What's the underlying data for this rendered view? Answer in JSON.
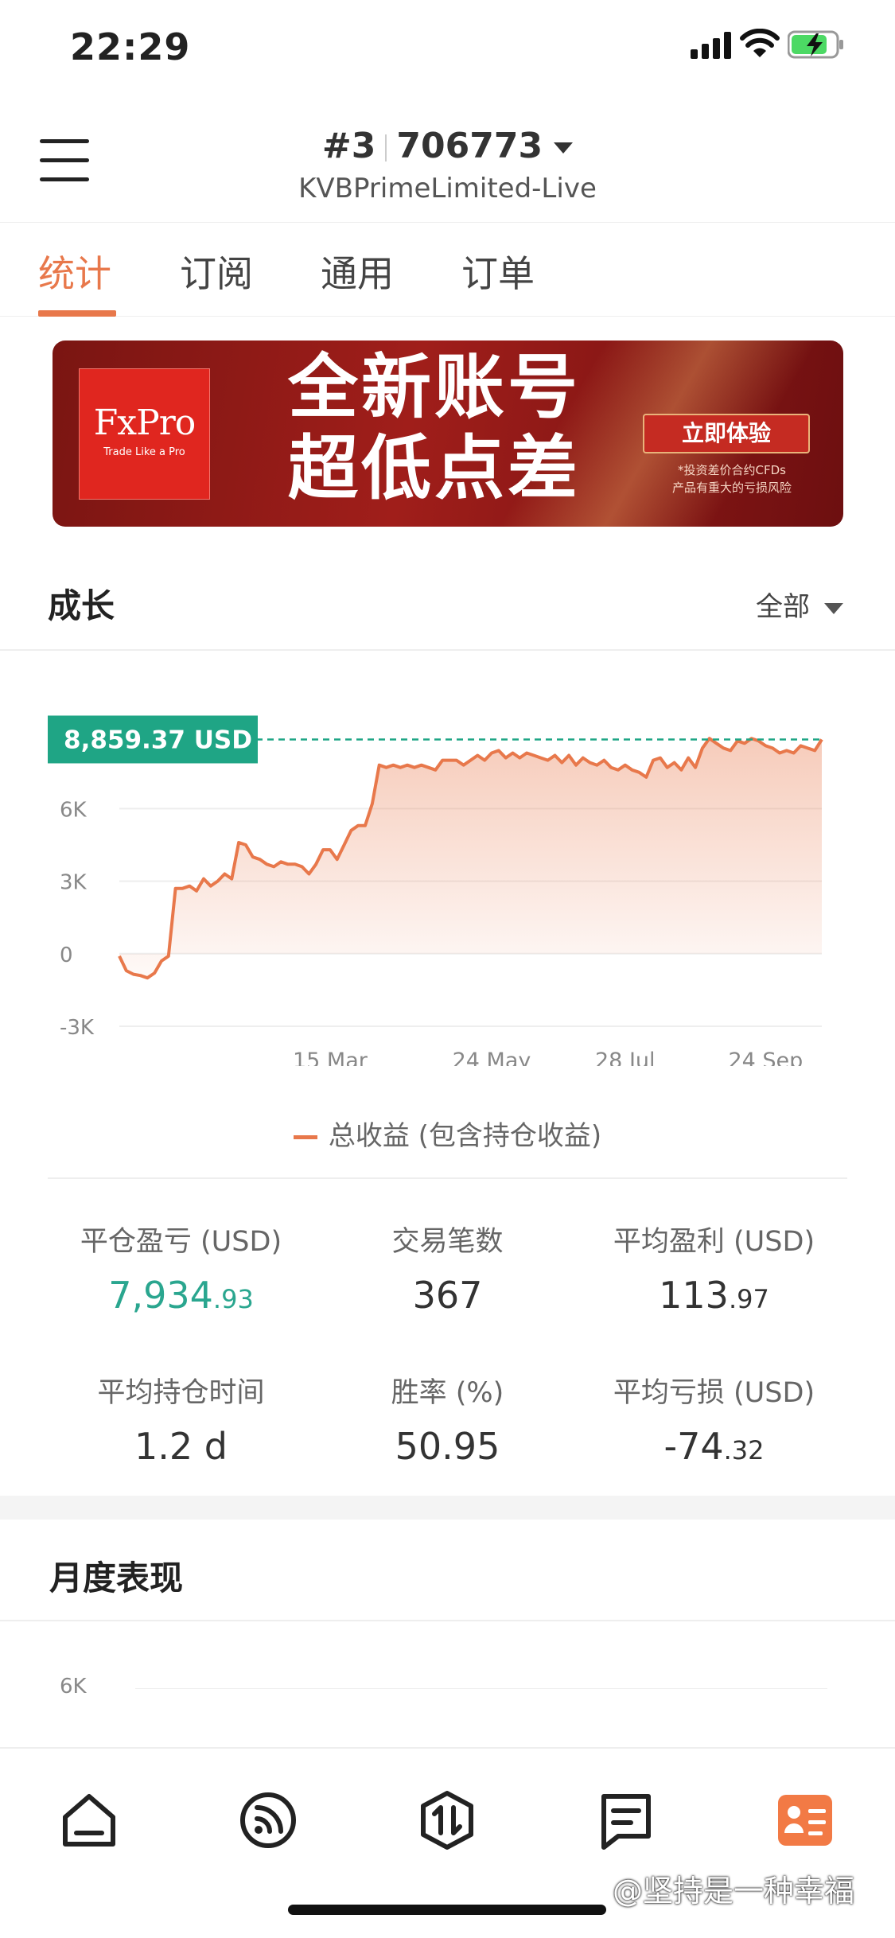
{
  "status_bar": {
    "time": "22:29"
  },
  "header": {
    "account_index": "#3",
    "account_number": "706773",
    "broker": "KVBPrimeLimited-Live"
  },
  "tabs": [
    {
      "label": "统计",
      "active": true
    },
    {
      "label": "订阅",
      "active": false
    },
    {
      "label": "通用",
      "active": false
    },
    {
      "label": "订单",
      "active": false
    }
  ],
  "banner": {
    "logo": "FxPro",
    "logo_tagline": "Trade Like a Pro",
    "headline_line1": "全新账号",
    "headline_line2": "超低点差",
    "cta": "立即体验",
    "disclaimer_line1": "*投资差价合约CFDs",
    "disclaimer_line2": "产品有重大的亏损风险"
  },
  "growth": {
    "title": "成长",
    "filter": "全部"
  },
  "chart_data": {
    "type": "area",
    "title": "",
    "current_value_label": "8,859.37 USD",
    "current_value": 8859.37,
    "y_ticks": [
      "6K",
      "3K",
      "0",
      "-3K"
    ],
    "x_ticks": [
      "15 Mar",
      "24 May",
      "28 Jul",
      "24 Sep"
    ],
    "ylim": [
      -3000,
      9500
    ],
    "grid": true,
    "legend_position": "bottom",
    "series": [
      {
        "name": "总收益 (包含持仓收益)",
        "color": "#E8784B",
        "x": [
          0,
          1,
          2,
          3,
          4,
          5,
          6,
          7,
          8,
          9,
          10,
          11,
          12,
          13,
          14,
          15,
          16,
          17,
          18,
          19,
          20,
          21,
          22,
          23,
          24,
          25,
          26,
          27,
          28,
          29,
          30,
          31,
          32,
          33,
          34,
          35,
          36,
          37,
          38,
          39,
          40,
          41,
          42,
          43,
          44,
          45,
          46,
          47,
          48,
          49,
          50,
          51,
          52,
          53,
          54,
          55,
          56,
          57,
          58,
          59,
          60,
          61,
          62,
          63,
          64,
          65,
          66,
          67,
          68,
          69,
          70,
          71,
          72,
          73,
          74,
          75,
          76,
          77,
          78,
          79,
          80,
          81,
          82,
          83,
          84,
          85,
          86,
          87,
          88,
          89,
          90,
          91,
          92,
          93,
          94,
          95,
          96,
          97,
          98,
          99,
          100
        ],
        "y": [
          -100,
          -700,
          -850,
          -900,
          -1000,
          -800,
          -300,
          -100,
          2700,
          2700,
          2800,
          2600,
          3100,
          2800,
          3000,
          3300,
          3100,
          4600,
          4500,
          4000,
          3900,
          3700,
          3600,
          3800,
          3700,
          3700,
          3600,
          3300,
          3700,
          4300,
          4300,
          3900,
          4500,
          5100,
          5300,
          5300,
          6200,
          7800,
          7700,
          7800,
          7700,
          7800,
          7700,
          7800,
          7700,
          7600,
          8000,
          8000,
          8000,
          7800,
          8000,
          8200,
          8000,
          8300,
          8400,
          8100,
          8300,
          8100,
          8300,
          8200,
          8100,
          8000,
          8200,
          7900,
          8200,
          7800,
          8100,
          7900,
          7800,
          8000,
          7700,
          7600,
          7800,
          7600,
          7500,
          7300,
          8000,
          8100,
          7700,
          7900,
          7600,
          8100,
          7700,
          8500,
          8900,
          8700,
          8500,
          8400,
          8800,
          8700,
          8900,
          8800,
          8600,
          8500,
          8300,
          8400,
          8300,
          8600,
          8500,
          8400,
          8859
        ]
      }
    ]
  },
  "stats": [
    {
      "label": "平仓盈亏 (USD)",
      "int": "7,934",
      "dec": ".93",
      "highlight": true
    },
    {
      "label": "交易笔数",
      "int": "367",
      "dec": ""
    },
    {
      "label": "平均盈利 (USD)",
      "int": "113",
      "dec": ".97"
    },
    {
      "label": "平均持仓时间",
      "int": "1.2 d",
      "dec": ""
    },
    {
      "label": "胜率 (%)",
      "int": "50.95",
      "dec": ""
    },
    {
      "label": "平均亏损 (USD)",
      "int": "-74",
      "dec": ".32"
    }
  ],
  "monthly": {
    "title": "月度表现",
    "y_tick": "6K"
  },
  "bottom_nav": [
    {
      "icon": "home-icon",
      "active": false
    },
    {
      "icon": "signal-feed-icon",
      "active": false
    },
    {
      "icon": "trade-arrows-icon",
      "active": false
    },
    {
      "icon": "message-icon",
      "active": false
    },
    {
      "icon": "profile-card-icon",
      "active": true
    }
  ],
  "colors": {
    "accent": "#E8784B",
    "positive": "#2aa68f",
    "value_tag": "#1fa585"
  },
  "watermark": "@坚持是一种幸福"
}
